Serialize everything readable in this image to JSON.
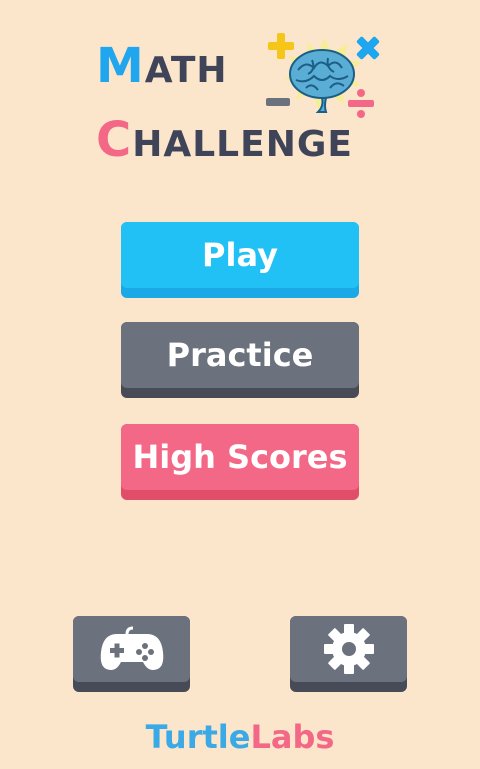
{
  "app": {
    "title_line1_initial": "M",
    "title_line1_rest": "ATH",
    "title_line2_initial": "C",
    "title_line2_rest": "HALLENGE"
  },
  "menu": {
    "play_label": "Play",
    "practice_label": "Practice",
    "high_scores_label": "High Scores"
  },
  "bottom_buttons": {
    "games_icon": "gamepad-icon",
    "settings_icon": "gear-icon"
  },
  "footer": {
    "brand_part1": "Turtle",
    "brand_part2": "Labs"
  },
  "colors": {
    "background": "#fbe6cc",
    "play": "#21c1f5",
    "practice": "#6c717e",
    "high_scores": "#f36886",
    "title_m": "#1fa6ee",
    "title_c": "#f36886",
    "title_text": "#3f4458",
    "brand_turtle": "#3aa9e6",
    "brand_labs": "#f36886"
  }
}
